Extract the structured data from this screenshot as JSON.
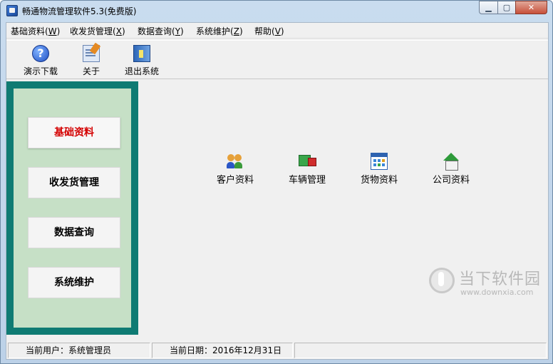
{
  "window": {
    "title": "畅通物流管理软件5.3(免费版)",
    "buttons": {
      "minimize": "▁",
      "maximize": "▢",
      "close": "✕"
    }
  },
  "menubar": {
    "items": [
      {
        "label": "基础资料",
        "hotkey": "W"
      },
      {
        "label": "收发货管理",
        "hotkey": "X"
      },
      {
        "label": "数据查询",
        "hotkey": "Y"
      },
      {
        "label": "系统维护",
        "hotkey": "Z"
      },
      {
        "label": "帮助",
        "hotkey": "V"
      }
    ]
  },
  "toolbar": {
    "items": [
      {
        "label": "演示下载",
        "icon": "help-icon"
      },
      {
        "label": "关于",
        "icon": "about-icon"
      },
      {
        "label": "退出系统",
        "icon": "exit-icon"
      }
    ]
  },
  "sidebar": {
    "items": [
      {
        "label": "基础资料",
        "active": true
      },
      {
        "label": "收发货管理",
        "active": false
      },
      {
        "label": "数据查询",
        "active": false
      },
      {
        "label": "系统维护",
        "active": false
      }
    ],
    "colors": {
      "frame": "#0f7b73",
      "panel": "#c6e0c6",
      "active_text": "#d40000"
    }
  },
  "main": {
    "launchers": [
      {
        "label": "客户资料",
        "icon": "customer-icon"
      },
      {
        "label": "车辆管理",
        "icon": "vehicle-icon"
      },
      {
        "label": "货物资料",
        "icon": "cargo-icon"
      },
      {
        "label": "公司资料",
        "icon": "company-icon"
      }
    ]
  },
  "watermark": {
    "title": "当下软件园",
    "url": "www.downxia.com"
  },
  "statusbar": {
    "user": "当前用户：系统管理员",
    "date": "当前日期：2016年12月31日"
  }
}
